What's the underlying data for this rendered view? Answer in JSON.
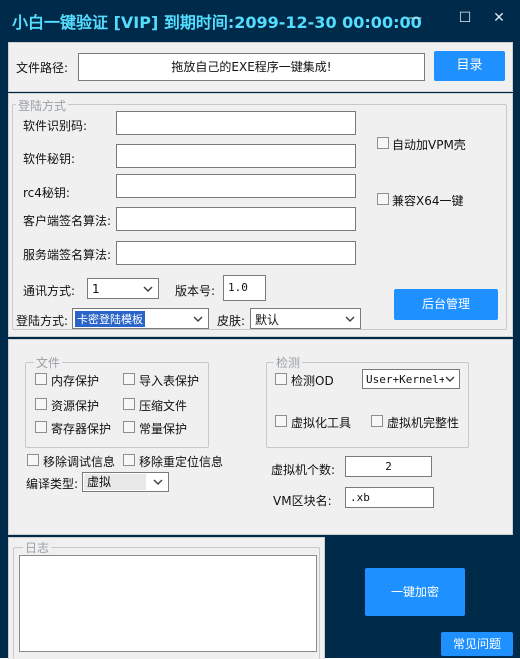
{
  "window": {
    "title": "小白一键验证 [VIP]  到期时间:2099-12-30 00:00:00",
    "minimize": "—",
    "maximize": "☐",
    "close": "✕"
  },
  "filepath": {
    "label": "文件路径:",
    "value": "拖放自己的EXE程序一键集成!",
    "button": "目录"
  },
  "login": {
    "group_title": "登陆方式",
    "software_id_label": "软件识别码:",
    "software_key_label": "软件秘钥:",
    "rc4_label": "rc4秘钥:",
    "client_sign_label": "客户端签名算法:",
    "server_sign_label": "服务端签名算法:",
    "vpm_label": "自动加VPM壳",
    "x64_label": "兼容X64一键",
    "comm_label": "通讯方式:",
    "comm_value": "1",
    "version_label": "版本号:",
    "version_value": "1.0",
    "admin_button": "后台管理",
    "method_label": "登陆方式:",
    "method_value": "卡密登陆模板",
    "skin_label": "皮肤:",
    "skin_value": "默认"
  },
  "files": {
    "group_title": "文件",
    "memory": "内存保护",
    "import": "导入表保护",
    "resource": "资源保护",
    "compress": "压缩文件",
    "register": "寄存器保护",
    "constant": "常量保护",
    "remove_debug": "移除调试信息",
    "remove_reloc": "移除重定位信息",
    "compile_label": "编译类型:",
    "compile_value": "虚拟"
  },
  "detect": {
    "group_title": "检测",
    "od_label": "检测OD",
    "od_value": "User+Kernel+M",
    "vm_tool": "虚拟化工具",
    "vm_integrity": "虚拟机完整性",
    "vm_count_label": "虚拟机个数:",
    "vm_count_value": "2",
    "vm_section_label": "VM区块名:",
    "vm_section_value": ".xb"
  },
  "log": {
    "group_title": "日志"
  },
  "actions": {
    "encrypt": "一键加密",
    "faq": "常见问题"
  }
}
